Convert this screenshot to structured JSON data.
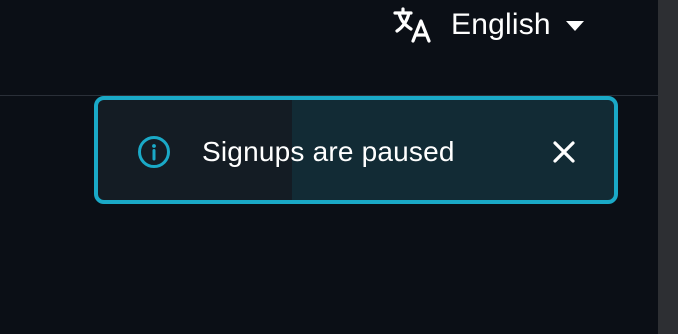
{
  "header": {
    "language_selector": {
      "selected": "English",
      "icon": "translate-icon",
      "caret_icon": "caret-down-icon"
    }
  },
  "toast": {
    "message": "Signups are paused",
    "icon": "info-icon",
    "close_icon": "close-icon",
    "colors": {
      "border": "#1aa9c7",
      "background_left": "#141c24",
      "background_right": "#122b35",
      "text": "#ffffff",
      "icon": "#1aa9c7"
    }
  },
  "colors": {
    "page_background": "#0b0f16",
    "scrollbar": "#2d2f33"
  }
}
